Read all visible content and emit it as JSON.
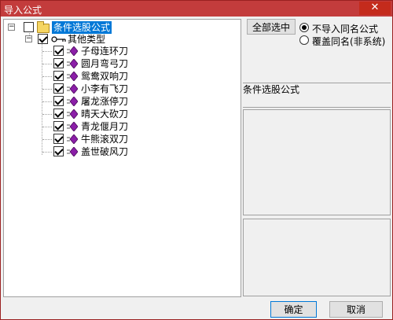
{
  "window": {
    "title": "导入公式",
    "close_glyph": "✕"
  },
  "tree": {
    "root": {
      "label": "条件选股公式",
      "expander": "−"
    },
    "group": {
      "label": "其他类型",
      "expander": "−"
    },
    "items": [
      {
        "label": "子母连环刀"
      },
      {
        "label": "圆月弯弓刀"
      },
      {
        "label": "鸳鸯双响刀"
      },
      {
        "label": "小李有飞刀"
      },
      {
        "label": "屠龙涨停刀"
      },
      {
        "label": "晴天大砍刀"
      },
      {
        "label": "青龙偃月刀"
      },
      {
        "label": "牛熊滚双刀"
      },
      {
        "label": "盖世破风刀"
      }
    ]
  },
  "options": {
    "select_all_label": "全部选中",
    "radio_no_import_label": "不导入同名公式",
    "radio_overwrite_label": "覆盖同名(非系统)"
  },
  "details": {
    "formula_label": "条件选股公式"
  },
  "footer": {
    "ok_label": "确定",
    "cancel_label": "取消"
  },
  "colors": {
    "titlebar": "#c33c3c",
    "selection": "#0078d7",
    "gem": "#8b1fa8"
  }
}
